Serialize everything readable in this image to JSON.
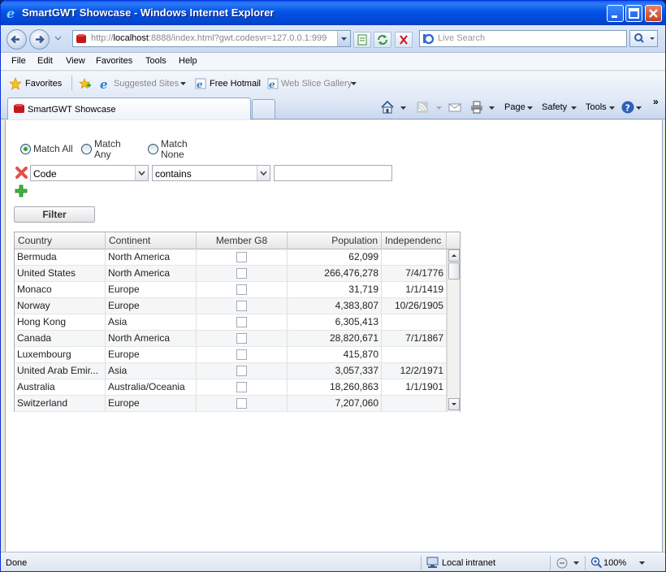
{
  "window": {
    "title": "SmartGWT Showcase - Windows Internet Explorer"
  },
  "nav": {
    "url_prefix": "http://",
    "url_host": "localhost",
    "url_rest": ":8888/index.html?gwt.codesvr=127.0.0.1:999",
    "search_placeholder": "Live Search"
  },
  "menu": {
    "items": [
      "File",
      "Edit",
      "View",
      "Favorites",
      "Tools",
      "Help"
    ]
  },
  "favorites_bar": {
    "favorites_label": "Favorites",
    "suggested_sites": "Suggested Sites",
    "free_hotmail": "Free Hotmail",
    "web_slice_gallery": "Web Slice Gallery"
  },
  "tab": {
    "label": "SmartGWT Showcase"
  },
  "commands": {
    "page": "Page",
    "safety": "Safety",
    "tools": "Tools",
    "overflow": "»"
  },
  "filter": {
    "match_all": "Match All",
    "match_any_line1": "Match",
    "match_any_line2": "Any",
    "match_none_line1": "Match",
    "match_none_line2": "None",
    "selected_mode": "match_all",
    "field_value": "Code",
    "operator_value": "contains",
    "criteria_value": "",
    "filter_button": "Filter"
  },
  "grid": {
    "columns": [
      "Country",
      "Continent",
      "Member G8",
      "Population",
      "Independenc"
    ],
    "rows": [
      {
        "country": "Bermuda",
        "continent": "North America",
        "g8": false,
        "population": "62,099",
        "independence": ""
      },
      {
        "country": "United States",
        "continent": "North America",
        "g8": false,
        "population": "266,476,278",
        "independence": "7/4/1776"
      },
      {
        "country": "Monaco",
        "continent": "Europe",
        "g8": false,
        "population": "31,719",
        "independence": "1/1/1419"
      },
      {
        "country": "Norway",
        "continent": "Europe",
        "g8": false,
        "population": "4,383,807",
        "independence": "10/26/1905"
      },
      {
        "country": "Hong Kong",
        "continent": "Asia",
        "g8": false,
        "population": "6,305,413",
        "independence": ""
      },
      {
        "country": "Canada",
        "continent": "North America",
        "g8": false,
        "population": "28,820,671",
        "independence": "7/1/1867"
      },
      {
        "country": "Luxembourg",
        "continent": "Europe",
        "g8": false,
        "population": "415,870",
        "independence": ""
      },
      {
        "country": "United Arab Emir...",
        "continent": "Asia",
        "g8": false,
        "population": "3,057,337",
        "independence": "12/2/1971"
      },
      {
        "country": "Australia",
        "continent": "Australia/Oceania",
        "g8": false,
        "population": "18,260,863",
        "independence": "1/1/1901"
      },
      {
        "country": "Switzerland",
        "continent": "Europe",
        "g8": false,
        "population": "7,207,060",
        "independence": ""
      }
    ]
  },
  "status": {
    "left": "Done",
    "zone": "Local intranet",
    "zoom": "100%"
  }
}
